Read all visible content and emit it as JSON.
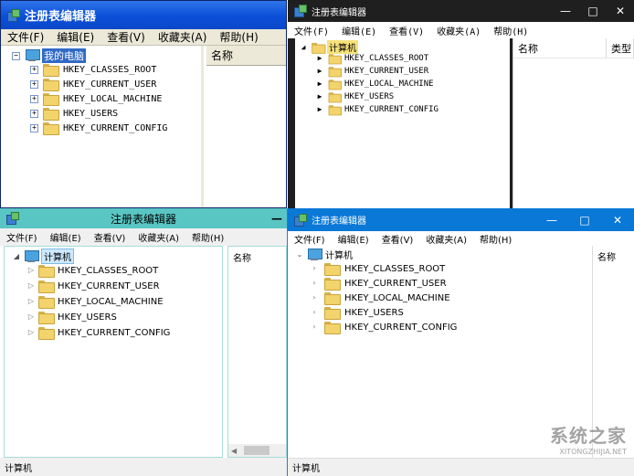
{
  "menu": [
    "文件(F)",
    "编辑(E)",
    "查看(V)",
    "收藏夹(A)",
    "帮助(H)"
  ],
  "hkeys": [
    "HKEY_CLASSES_ROOT",
    "HKEY_CURRENT_USER",
    "HKEY_LOCAL_MACHINE",
    "HKEY_USERS",
    "HKEY_CURRENT_CONFIG"
  ],
  "column_name": "名称",
  "column_type": "类型",
  "xp": {
    "title": "注册表编辑器",
    "menu": [
      "文件(F)",
      "编辑(E)",
      "查看(V)",
      "收藏夹(A)",
      "帮助(H)"
    ],
    "root": "我的电脑"
  },
  "win7": {
    "title": "注册表编辑器",
    "menu": [
      "文件(F)",
      "编辑(E)",
      "查看(V)",
      "收藏夹(A)",
      "帮助(H)"
    ],
    "root": "计算机",
    "controls": [
      "—",
      "□",
      "✕"
    ]
  },
  "win8": {
    "title": "注册表编辑器",
    "root": "计算机",
    "status": "计算机",
    "controls": [
      "—"
    ]
  },
  "win10": {
    "title": "注册表编辑器",
    "root": "计算机",
    "status": "计算机",
    "controls": [
      "—",
      "□",
      "✕"
    ],
    "watermark": "系统之家",
    "watermark_url": "XITONGZHIJIA.NET"
  },
  "colors": {
    "xp_title": "#0b4fd8",
    "win8_title": "#5ac6c4",
    "win10_title": "#0a78d7",
    "folder": "#f3d36b"
  }
}
